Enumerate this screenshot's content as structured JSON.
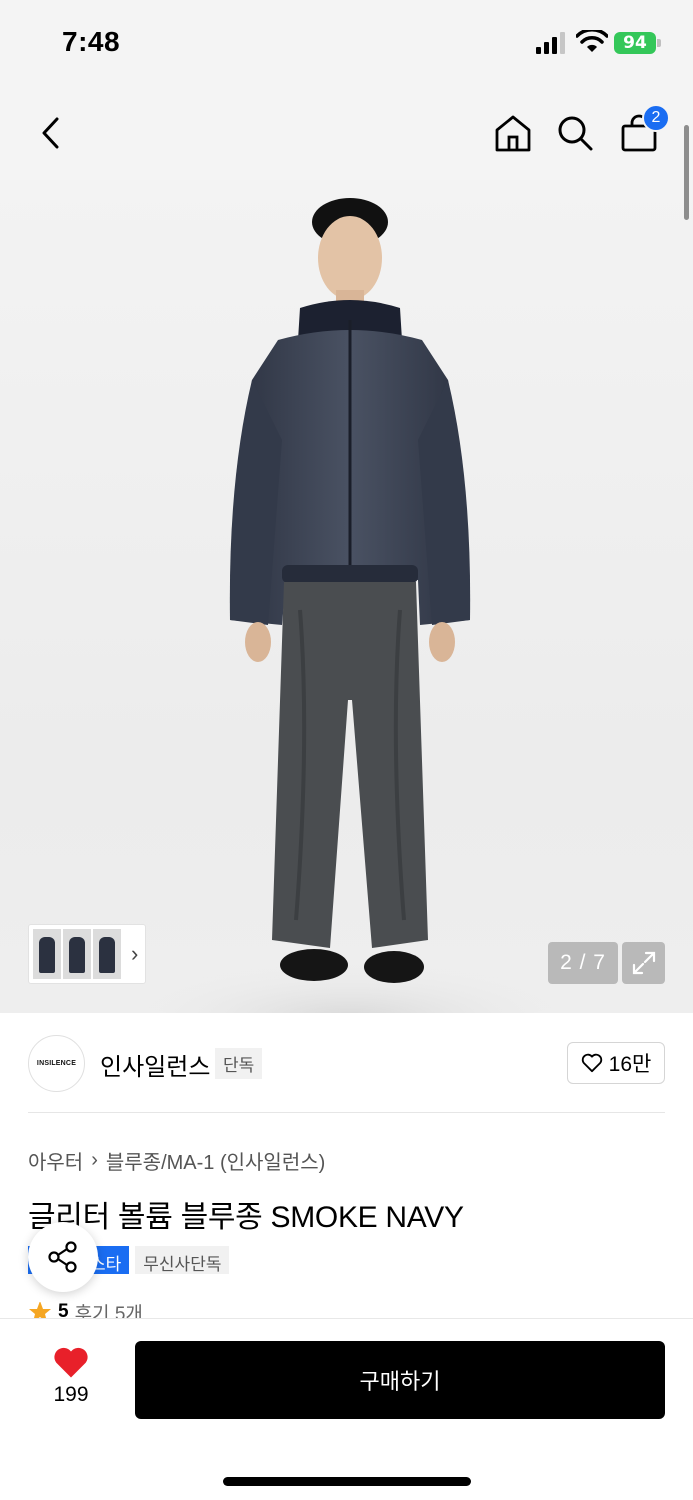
{
  "status_bar": {
    "time": "7:48",
    "battery": "94"
  },
  "nav": {
    "back_icon": "chevron-left-icon",
    "home_icon": "home-icon",
    "search_icon": "search-icon",
    "cart_icon": "shopping-bag-icon",
    "cart_count": "2"
  },
  "gallery": {
    "counter": "2 / 7",
    "expand_icon": "expand-icon",
    "thumb_arrow": "›"
  },
  "brand": {
    "logo_text": "INSILENCE",
    "name": "인사일런스",
    "exclusive_tag": "단독",
    "likes": "16만"
  },
  "product": {
    "breadcrumb": [
      "아우터",
      "블루종/MA-1 (인사일런스)"
    ],
    "title": "글리터 볼륨 블루종 SMOKE NAVY",
    "tags": [
      "스타",
      "무신사단독"
    ],
    "rating": "5",
    "review_count": "후기 5개"
  },
  "bottom": {
    "wish_count": "199",
    "buy_label": "구매하기"
  },
  "colors": {
    "accent_blue": "#1a6df2",
    "heart_red": "#e8202a",
    "battery_green": "#34c759",
    "star_orange": "#f5a623"
  }
}
